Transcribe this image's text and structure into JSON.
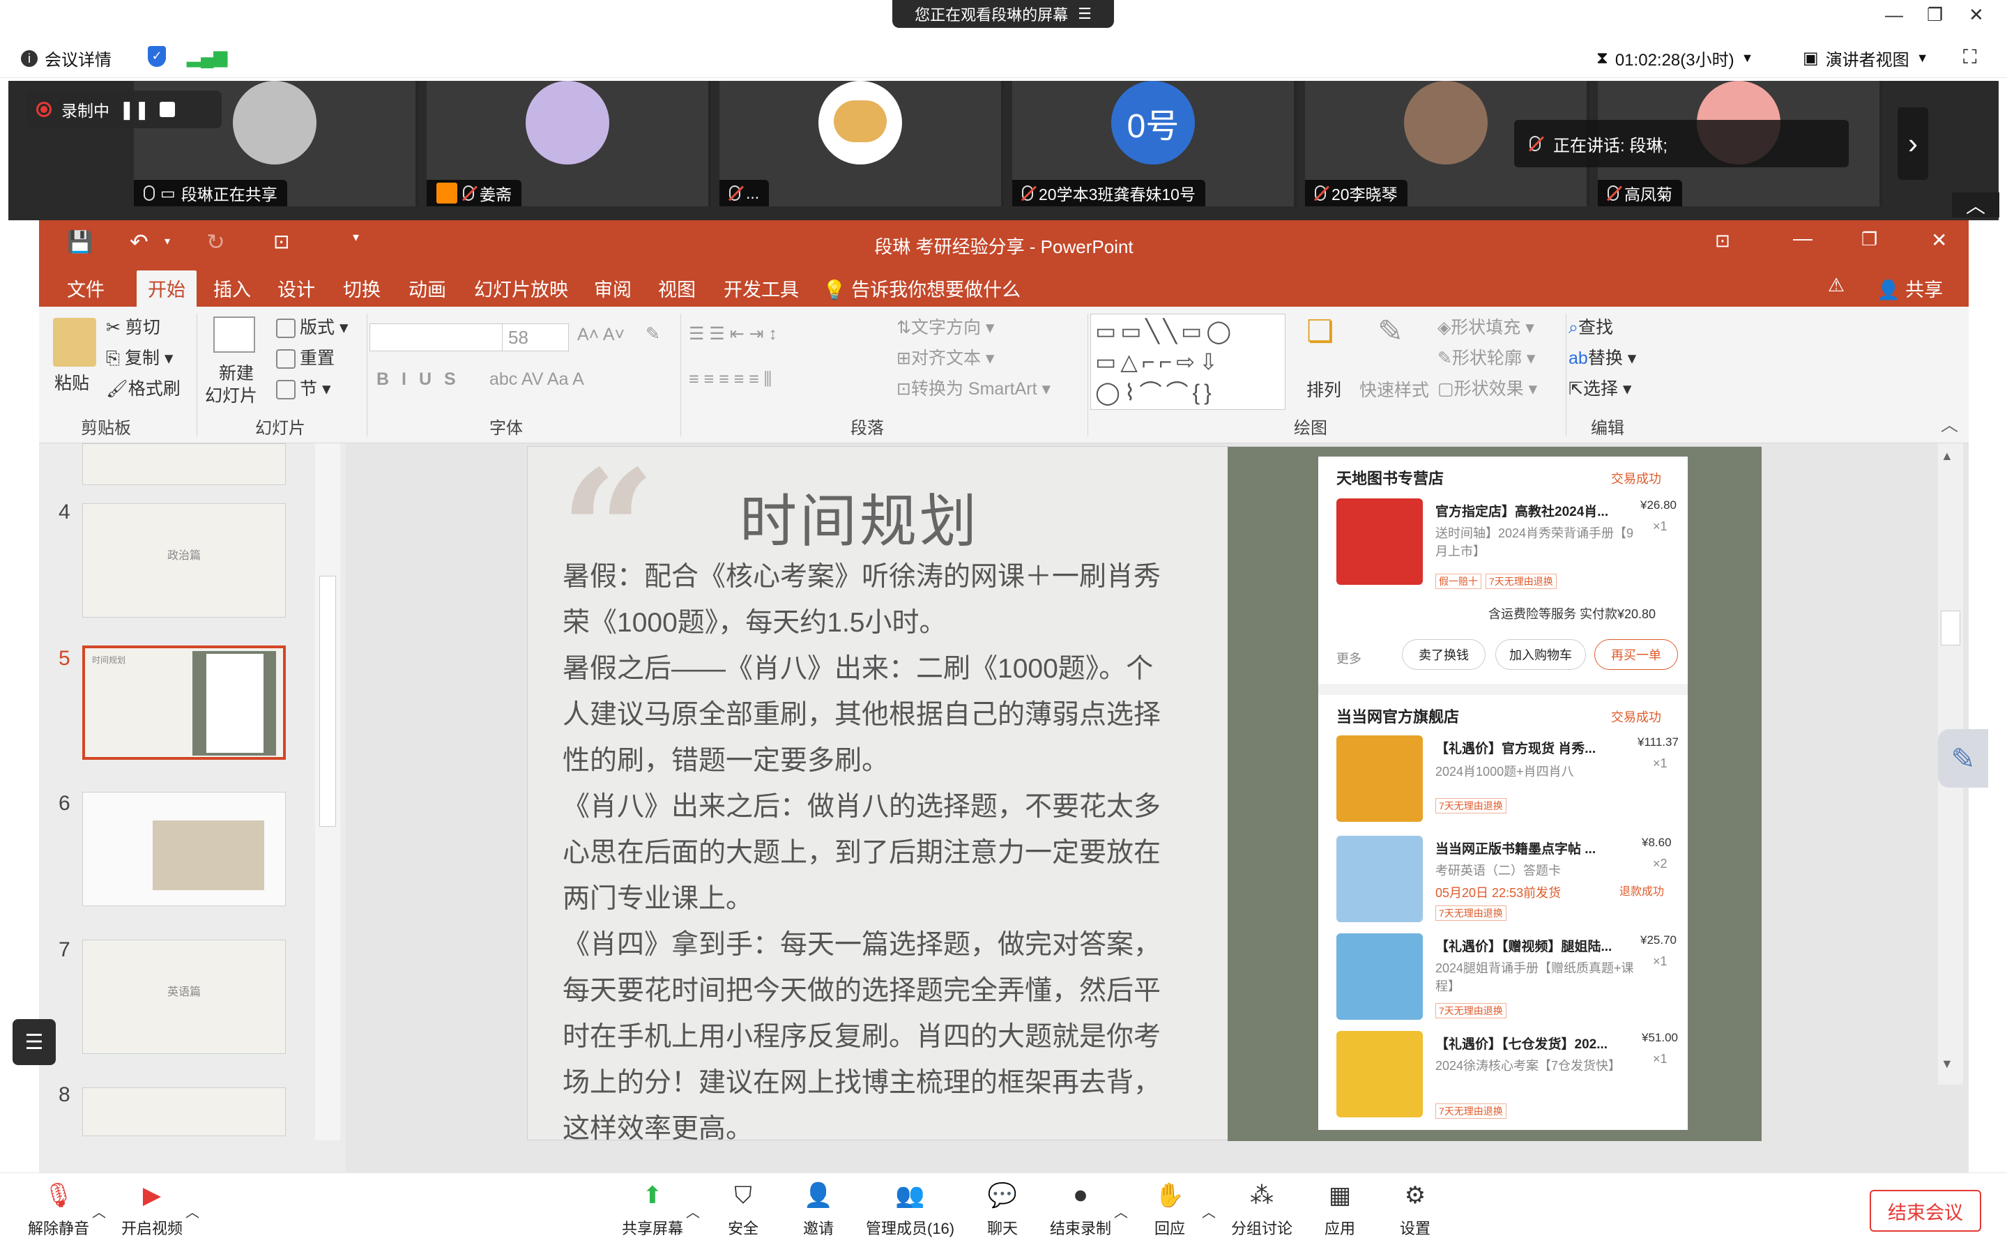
{
  "meeting": {
    "share_banner": "您正在观看段琳的屏幕",
    "details": "会议详情",
    "timer": "01:02:28(3小时)",
    "view_mode": "演讲者视图",
    "recording": "录制中",
    "speaking": "正在讲话:  段琳;",
    "participants": [
      {
        "name": "段琳正在共享",
        "avatar_color": "#d8d8d8"
      },
      {
        "name": "姜斋",
        "avatar_color": "#c6b6e6"
      },
      {
        "name": "...",
        "avatar_color": "#ffffff"
      },
      {
        "name": "20学本3班龚春妹10号",
        "avatar_color": "#2f6fd1",
        "avatar_text": "0号"
      },
      {
        "name": "20李晓琴",
        "avatar_color": "#8c6e5a"
      },
      {
        "name": "高凤菊",
        "avatar_color": "#f1a5a0"
      }
    ]
  },
  "ppt": {
    "title": "段琳  考研经验分享  -  PowerPoint",
    "tabs": [
      "文件",
      "开始",
      "插入",
      "设计",
      "切换",
      "动画",
      "幻灯片放映",
      "审阅",
      "视图",
      "开发工具"
    ],
    "tell_me": "告诉我你想要做什么",
    "share": "共享",
    "ribbon": {
      "paste": "粘贴",
      "cut": "剪切",
      "copy": "复制",
      "format_painter": "格式刷",
      "clipboard": "剪贴板",
      "new_slide_1": "新建",
      "new_slide_2": "幻灯片",
      "layout": "版式",
      "reset": "重置",
      "section": "节",
      "slides": "幻灯片",
      "font_size": "58",
      "font": "字体",
      "text_direction": "文字方向",
      "align_text": "对齐文本",
      "smartart": "转换为 SmartArt",
      "paragraph": "段落",
      "arrange": "排列",
      "quick_styles": "快速样式",
      "shape_fill": "形状填充",
      "shape_outline": "形状轮廓",
      "shape_effects": "形状效果",
      "drawing": "绘图",
      "find": "查找",
      "replace": "替换",
      "select": "选择",
      "editing": "编辑"
    },
    "thumbs": [
      {
        "num": "4",
        "label": "政治篇"
      },
      {
        "num": "5",
        "label": "时间规划"
      },
      {
        "num": "6",
        "label": ""
      },
      {
        "num": "7",
        "label": "英语篇"
      },
      {
        "num": "8",
        "label": ""
      }
    ],
    "slide": {
      "title": "时间规划",
      "paragraphs": [
        "暑假：配合《核心考案》听徐涛的网课＋一刷肖秀荣《1000题》，每天约1.5小时。",
        "暑假之后——《肖八》出来：二刷《1000题》。个人建议马原全部重刷，其他根据自己的薄弱点选择性的刷，错题一定要多刷。",
        "《肖八》出来之后：做肖八的选择题，不要花太多心思在后面的大题上，到了后期注意力一定要放在两门专业课上。",
        "《肖四》拿到手：每天一篇选择题，做完对答案，每天要花时间把今天做的选择题完全弄懂，然后平时在手机上用小程序反复刷。肖四的大题就是你考场上的分！建议在网上找博主梳理的框架再去背，这样效率更高。"
      ]
    },
    "orders": [
      {
        "shop": "天地图书专营店",
        "status": "交易成功",
        "items": [
          {
            "title": "官方指定店】高教社2024肖...",
            "sub": "送时间轴】2024肖秀荣背诵手册【9月上市】",
            "price": "¥26.80",
            "qty": "×1",
            "tags": [
              "假一赔十",
              "7天无理由退换"
            ],
            "img": "#d9312b"
          }
        ],
        "summary": "含运费险等服务  实付款¥20.80",
        "more": "更多",
        "buttons": [
          "卖了换钱",
          "加入购物车",
          "再买一单"
        ]
      },
      {
        "shop": "当当网官方旗舰店",
        "status": "交易成功",
        "items": [
          {
            "title": "【礼遇价】官方现货 肖秀...",
            "sub": "2024肖1000题+肖四肖八",
            "price": "¥111.37",
            "qty": "×1",
            "tags": [
              "7天无理由退换"
            ],
            "img": "#e8a227"
          },
          {
            "title": "当当网正版书籍墨点字帖 ...",
            "sub": "考研英语（二）答题卡",
            "sub2": "05月20日 22:53前发货",
            "price": "¥8.60",
            "qty": "×2",
            "extra": "退款成功",
            "tags": [
              "7天无理由退换"
            ],
            "img": "#9cc7e8"
          },
          {
            "title": "【礼遇价】【赠视频】腿姐陆...",
            "sub": "2024腿姐背诵手册【赠纸质真题+课程】",
            "price": "¥25.70",
            "qty": "×1",
            "tags": [
              "7天无理由退换"
            ],
            "img": "#6fb3e0"
          },
          {
            "title": "【礼遇价】【七仓发货】202...",
            "sub": "2024徐涛核心考案【7仓发货快】",
            "price": "¥51.00",
            "qty": "×1",
            "tags": [
              "7天无理由退换"
            ],
            "img": "#f0c030"
          }
        ]
      }
    ]
  },
  "toolbar": {
    "unmute": "解除静音",
    "start_video": "开启视频",
    "share_screen": "共享屏幕",
    "security": "安全",
    "invite": "邀请",
    "manage": "管理成员(16)",
    "chat": "聊天",
    "end_record": "结束录制",
    "reaction": "回应",
    "breakout": "分组讨论",
    "apps": "应用",
    "settings": "设置",
    "end_meeting": "结束会议"
  }
}
